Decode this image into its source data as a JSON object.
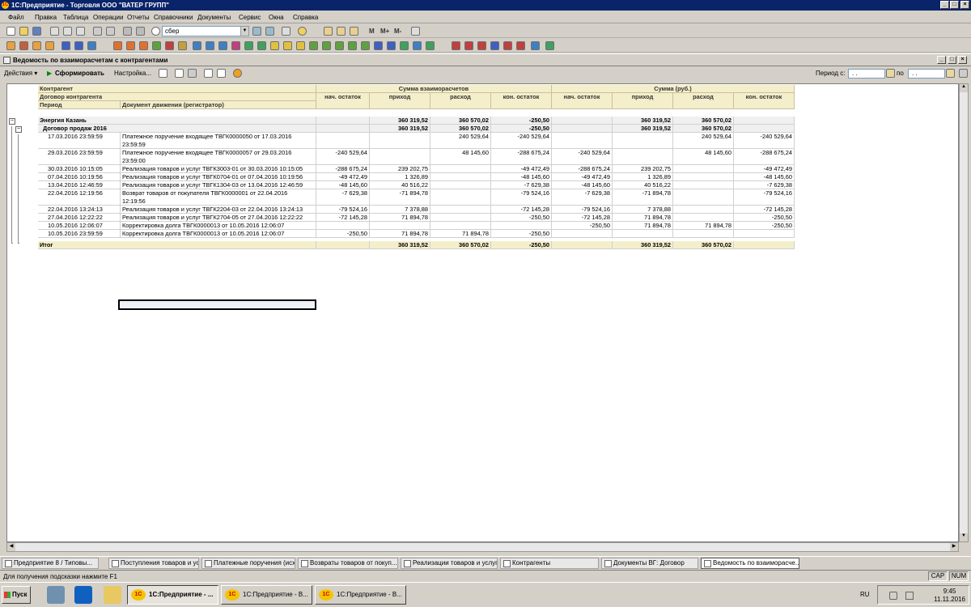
{
  "window": {
    "title": "1С:Предприятие - Торговля ООО \"ВАТЕР ГРУПП\"",
    "logo": "1С"
  },
  "menu": [
    "Файл",
    "Правка",
    "Таблица",
    "Операции",
    "Отчеты",
    "Справочники",
    "Документы",
    "Сервис",
    "Окна",
    "Справка"
  ],
  "toolbar": {
    "search_value": "сбер",
    "memory_buttons": [
      "M",
      "M+",
      "M-"
    ]
  },
  "document": {
    "title": "Ведомость по взаиморасчетам с контрагентами",
    "actions_label": "Действия",
    "generate_label": "Сформировать",
    "settings_label": "Настройка...",
    "period_from_label": "Период с:",
    "period_to_label": "по",
    "period_from": ". .",
    "period_to": ". ."
  },
  "report": {
    "headers": {
      "contragent": "Контрагент",
      "contract": "Договор контрагента",
      "period": "Период",
      "doc": "Документ движения (регистратор)",
      "group1": "Сумма взаиморасчетов",
      "group2": "Сумма (руб.)",
      "cols": [
        "нач. остаток",
        "приход",
        "расход",
        "кон. остаток",
        "нач. остаток",
        "приход",
        "расход",
        "кон. остаток"
      ]
    },
    "group_row": {
      "name": "Энергия Казань",
      "vals": [
        "",
        "360 319,52",
        "360 570,02",
        "-250,50",
        "",
        "360 319,52",
        "360 570,02",
        ""
      ]
    },
    "contract_row": {
      "name": "Договор продаж 2016",
      "vals": [
        "",
        "360 319,52",
        "360 570,02",
        "-250,50",
        "",
        "360 319,52",
        "360 570,02",
        ""
      ]
    },
    "rows": [
      {
        "period": "17.03.2016 23:59:59",
        "doc": "Платежное поручение входящее ТВГК0000050 от 17.03.2016",
        "doc2": "23:59:59",
        "vals": [
          "",
          "",
          "240 529,64",
          "-240 529,64",
          "",
          "",
          "240 529,64",
          "-240 529,64"
        ]
      },
      {
        "period": "29.03.2016 23:59:59",
        "doc": "Платежное поручение входящее ТВГК0000057 от 29.03.2016",
        "doc2": "23:59:00",
        "vals": [
          "-240 529,64",
          "",
          "48 145,60",
          "-288 675,24",
          "-240 529,64",
          "",
          "48 145,60",
          "-288 675,24"
        ]
      },
      {
        "period": "30.03.2016 10:15:05",
        "doc": "Реализация товаров и услуг ТВГК3003-01 от 30.03.2016 10:15:05",
        "doc2": "",
        "vals": [
          "-288 675,24",
          "239 202,75",
          "",
          "-49 472,49",
          "-288 675,24",
          "239 202,75",
          "",
          "-49 472,49"
        ]
      },
      {
        "period": "07.04.2016 10:19:56",
        "doc": "Реализация товаров и услуг ТВГК0704-01 от 07.04.2016 10:19:56",
        "doc2": "",
        "vals": [
          "-49 472,49",
          "1 326,89",
          "",
          "-48 145,60",
          "-49 472,49",
          "1 326,89",
          "",
          "-48 145,60"
        ]
      },
      {
        "period": "13.04.2016 12:46:59",
        "doc": "Реализация товаров и услуг ТВГК1304-03 от 13.04.2016 12:46:59",
        "doc2": "",
        "vals": [
          "-48 145,60",
          "40 516,22",
          "",
          "-7 629,38",
          "-48 145,60",
          "40 516,22",
          "",
          "-7 629,38"
        ]
      },
      {
        "period": "22.04.2016 12:19:56",
        "doc": "Возврат товаров от покупателя ТВГК0000001 от 22.04.2016",
        "doc2": "12:19:56",
        "vals": [
          "-7 629,38",
          "-71 894,78",
          "",
          "-79 524,16",
          "-7 629,38",
          "-71 894,78",
          "",
          "-79 524,16"
        ]
      },
      {
        "period": "22.04.2016 13:24:13",
        "doc": "Реализация товаров и услуг ТВГК2204-03 от 22.04.2016 13:24:13",
        "doc2": "",
        "vals": [
          "-79 524,16",
          "7 378,88",
          "",
          "-72 145,28",
          "-79 524,16",
          "7 378,88",
          "",
          "-72 145,28"
        ]
      },
      {
        "period": "27.04.2016 12:22:22",
        "doc": "Реализация товаров и услуг ТВГК2704-05 от 27.04.2016 12:22:22",
        "doc2": "",
        "vals": [
          "-72 145,28",
          "71 894,78",
          "",
          "-250,50",
          "-72 145,28",
          "71 894,78",
          "",
          "-250,50"
        ]
      },
      {
        "period": "10.05.2016 12:06:07",
        "doc": "Корректировка долга ТВГК0000013 от 10.05.2016 12:06:07",
        "doc2": "",
        "vals": [
          "",
          "",
          "",
          "",
          "-250,50",
          "71 894,78",
          "71 894,78",
          "-250,50"
        ]
      },
      {
        "period": "10.05.2016 23:59:59",
        "doc": "Корректировка долга ТВГК0000013 от 10.05.2016 12:06:07",
        "doc2": "",
        "vals": [
          "-250,50",
          "71 894,78",
          "71 894,78",
          "-250,50",
          "",
          "",
          "",
          ""
        ]
      }
    ],
    "total_row": {
      "name": "Итог",
      "vals": [
        "",
        "360 319,52",
        "360 570,02",
        "-250,50",
        "",
        "360 319,52",
        "360 570,02",
        ""
      ]
    }
  },
  "tasks": [
    "Предприятие 8 / Типовы...",
    "Поступления товаров и услуг",
    "Платежные поручения (исх...",
    "Возвраты товаров от покуп...",
    "Реализации товаров и услуг",
    "Контрагенты",
    "Документы ВГ: Договор",
    "Ведомость по взаиморасче..."
  ],
  "status": {
    "hint": "Для получения подсказки нажмите F1",
    "cap": "CAP",
    "num": "NUM"
  },
  "taskbar": {
    "start": "Пуск",
    "windows": [
      "1С:Предприятие - ...",
      "1С:Предприятие - В...",
      "1С:Предприятие - В..."
    ],
    "lang": "RU",
    "time": "9:45",
    "date": "11.11.2016"
  }
}
